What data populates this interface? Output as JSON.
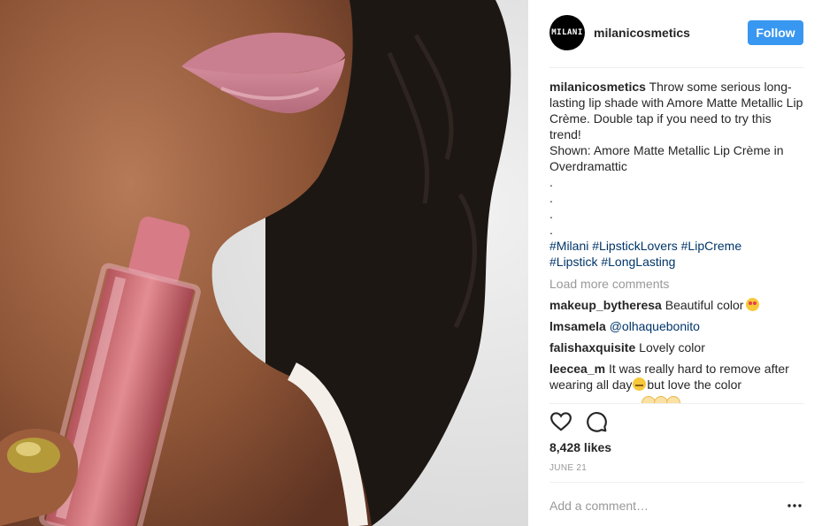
{
  "header": {
    "avatar_text": "MILANI",
    "username": "milanicosmetics",
    "follow_label": "Follow"
  },
  "caption": {
    "username": "milanicosmetics",
    "line1": "Throw some serious long-lasting lip shade with Amore Matte Metallic Lip Crème. Double tap if you need to try this trend!",
    "line2": "Shown: Amore Matte Metallic Lip Crème in Overdramattic",
    "dots": [
      ".",
      ".",
      ".",
      "."
    ],
    "hashtags": [
      "#Milani",
      "#LipstickLovers",
      "#LipCreme",
      "#Lipstick",
      "#LongLasting"
    ]
  },
  "load_more": "Load more comments",
  "comments": [
    {
      "user": "makeup_bytheresa",
      "text": "Beautiful color",
      "emoji": "heart-eyes-emoji"
    },
    {
      "user": "lmsamela",
      "mention": "@olhaquebonito"
    },
    {
      "user": "falishaxquisite",
      "text": "Lovely color"
    },
    {
      "user": "leecea_m",
      "text_before": "It was really hard to remove after wearing all day",
      "emoji": "sweat-smile-emoji",
      "text_after": "but love the color"
    }
  ],
  "actions": {
    "like_icon": "heart-icon",
    "comment_icon": "speech-bubble-icon"
  },
  "likes": "8,428 likes",
  "date": "JUNE 21",
  "add_comment_placeholder": "Add a comment…",
  "more_icon": "ellipsis-icon",
  "colors": {
    "follow": "#3897f0",
    "link": "#003569",
    "muted": "#999999",
    "text": "#262626"
  }
}
